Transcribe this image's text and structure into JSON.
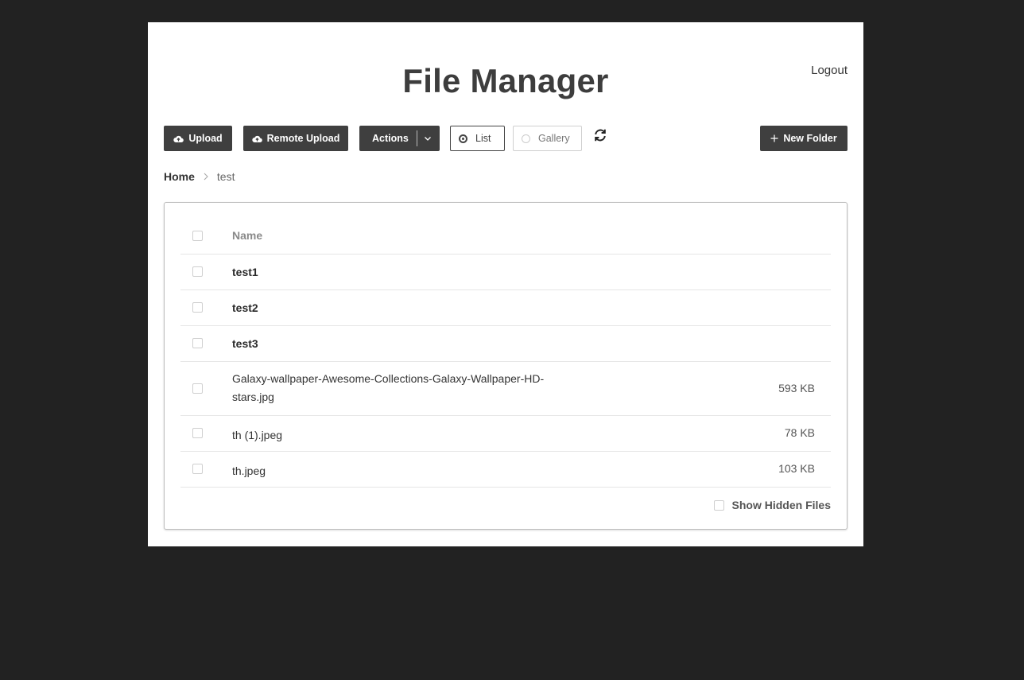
{
  "header": {
    "title": "File Manager",
    "logout_label": "Logout"
  },
  "toolbar": {
    "upload_label": "Upload",
    "remote_upload_label": "Remote Upload",
    "actions_label": "Actions",
    "view_list_label": "List",
    "view_gallery_label": "Gallery",
    "selected_view": "List",
    "new_folder_label": "New Folder",
    "icons": {
      "upload": "cloud-upload-icon",
      "remote_upload": "cloud-upload-icon",
      "actions_caret": "chevron-down-icon",
      "refresh": "refresh-icon",
      "new_folder": "plus-icon"
    }
  },
  "breadcrumb": {
    "home": "Home",
    "current": "test"
  },
  "table": {
    "header_name": "Name",
    "rows": [
      {
        "name": "test1",
        "type": "folder",
        "size": ""
      },
      {
        "name": "test2",
        "type": "folder",
        "size": ""
      },
      {
        "name": "test3",
        "type": "folder",
        "size": ""
      },
      {
        "name": "Galaxy-wallpaper-Awesome-Collections-Galaxy-Wallpaper-HD-stars.jpg",
        "type": "file",
        "size": "593 KB"
      },
      {
        "name": "th (1).jpeg",
        "type": "file",
        "size": "78 KB"
      },
      {
        "name": "th.jpeg",
        "type": "file",
        "size": "103 KB"
      }
    ]
  },
  "footer": {
    "show_hidden_label": "Show Hidden Files",
    "show_hidden_checked": false
  },
  "colors": {
    "page_background": "#222222",
    "panel_background": "#ffffff",
    "button_background": "#3f3f3f",
    "button_text": "#ffffff"
  }
}
